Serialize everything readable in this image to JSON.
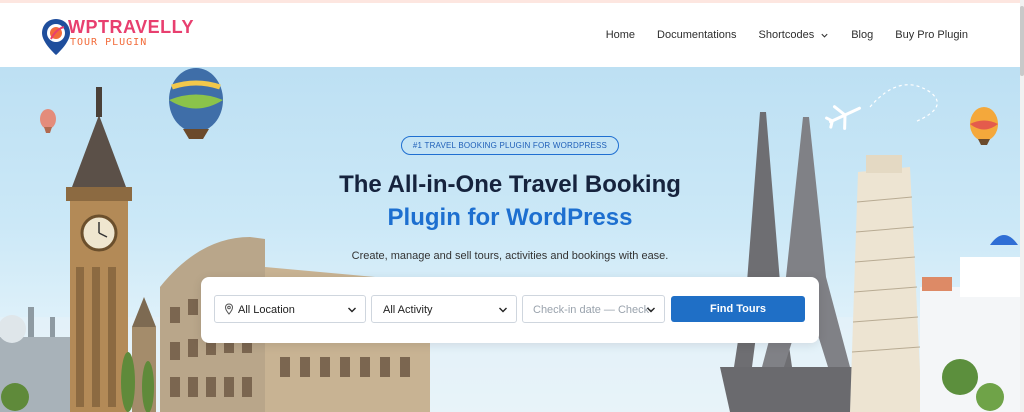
{
  "brand": {
    "name": "WPTRAVELLY",
    "tagline": "TOUR PLUGIN"
  },
  "nav": {
    "items": [
      "Home",
      "Documentations",
      "Shortcodes",
      "Blog",
      "Buy Pro Plugin"
    ]
  },
  "hero": {
    "badge": "#1 TRAVEL BOOKING PLUGIN FOR WORDPRESS",
    "title_line1": "The All-in-One Travel Booking",
    "title_line2": "Plugin for WordPress",
    "subtitle": "Create, manage and sell tours, activities and bookings with ease."
  },
  "search": {
    "location": "All Location",
    "activity": "All Activity",
    "dates": "Check-in date  —  Check-",
    "button": "Find Tours"
  },
  "colors": {
    "brand_pink": "#e83f6f",
    "brand_orange": "#f26b3a",
    "accent_blue": "#1d6fd0",
    "button_blue": "#1f6fc6",
    "title_dark": "#16233d"
  }
}
